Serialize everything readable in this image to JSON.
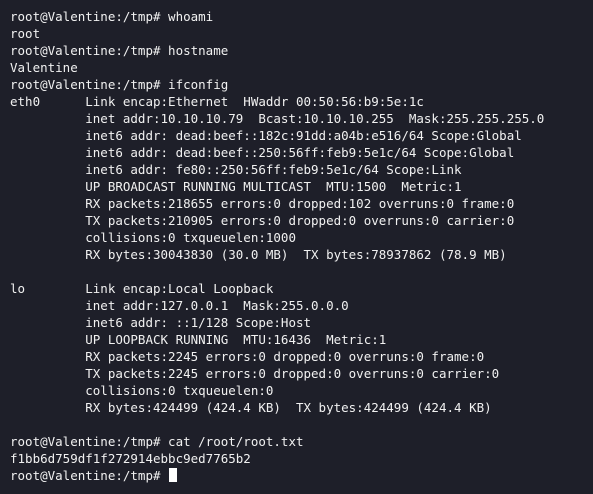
{
  "terminal": {
    "background": "#1e1f29",
    "foreground": "#f1f1f1",
    "lines": [
      "root@Valentine:/tmp# whoami",
      "root",
      "root@Valentine:/tmp# hostname",
      "Valentine",
      "root@Valentine:/tmp# ifconfig",
      "eth0      Link encap:Ethernet  HWaddr 00:50:56:b9:5e:1c",
      "          inet addr:10.10.10.79  Bcast:10.10.10.255  Mask:255.255.255.0",
      "          inet6 addr: dead:beef::182c:91dd:a04b:e516/64 Scope:Global",
      "          inet6 addr: dead:beef::250:56ff:feb9:5e1c/64 Scope:Global",
      "          inet6 addr: fe80::250:56ff:feb9:5e1c/64 Scope:Link",
      "          UP BROADCAST RUNNING MULTICAST  MTU:1500  Metric:1",
      "          RX packets:218655 errors:0 dropped:102 overruns:0 frame:0",
      "          TX packets:210905 errors:0 dropped:0 overruns:0 carrier:0",
      "          collisions:0 txqueuelen:1000",
      "          RX bytes:30043830 (30.0 MB)  TX bytes:78937862 (78.9 MB)",
      "",
      "lo        Link encap:Local Loopback",
      "          inet addr:127.0.0.1  Mask:255.0.0.0",
      "          inet6 addr: ::1/128 Scope:Host",
      "          UP LOOPBACK RUNNING  MTU:16436  Metric:1",
      "          RX packets:2245 errors:0 dropped:0 overruns:0 frame:0",
      "          TX packets:2245 errors:0 dropped:0 overruns:0 carrier:0",
      "          collisions:0 txqueuelen:0",
      "          RX bytes:424499 (424.4 KB)  TX bytes:424499 (424.4 KB)",
      "",
      "root@Valentine:/tmp# cat /root/root.txt",
      "f1bb6d759df1f272914ebbc9ed7765b2"
    ],
    "prompt": "root@Valentine:/tmp# "
  }
}
